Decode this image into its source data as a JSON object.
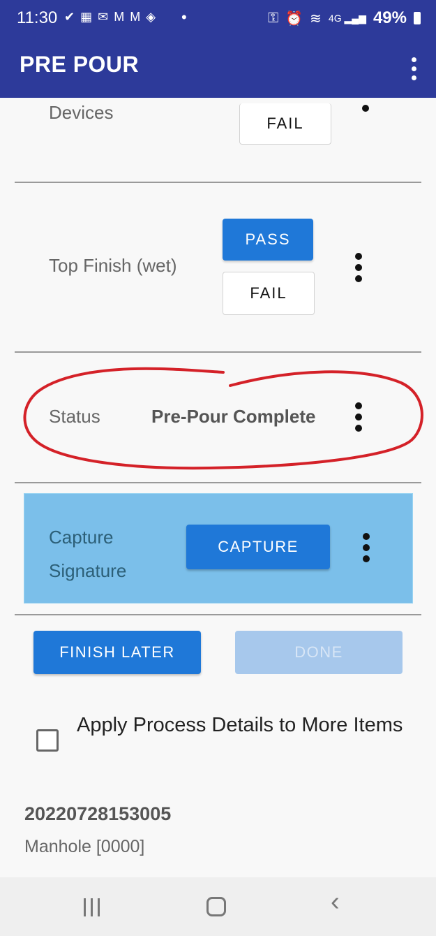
{
  "status_bar": {
    "time": "11:30",
    "battery": "49%",
    "left_icons": [
      "check-circle-icon",
      "calendar-icon",
      "outlook-icon",
      "gmail-icon",
      "gmail-icon",
      "shield-wifi-icon"
    ],
    "right_icons": [
      "key-icon",
      "alarm-icon",
      "wifi-icon",
      "4g-icon",
      "signal-icon",
      "battery-icon"
    ]
  },
  "app_bar": {
    "title": "PRE POUR",
    "menu_icon": "more-vert-icon"
  },
  "devices_row": {
    "label": "Devices",
    "fail_label": "FAIL"
  },
  "top_finish_row": {
    "label": "Top Finish (wet)",
    "pass_label": "PASS",
    "fail_label": "FAIL"
  },
  "status_row": {
    "label": "Status",
    "value": "Pre-Pour Complete"
  },
  "capture_row": {
    "label_line1": "Capture",
    "label_line2": "Signature",
    "button_label": "CAPTURE"
  },
  "actions": {
    "finish_later": "FINISH LATER",
    "done": "DONE"
  },
  "apply_details": {
    "label": "Apply Process Details to More Items",
    "checked": false
  },
  "item": {
    "id": "20220728153005",
    "subtitle": "Manhole [0000]"
  },
  "colors": {
    "app_bar": "#2d3a9a",
    "primary_button": "#1f78d8",
    "disabled_button": "#a7c8ec",
    "capture_panel": "#7bbfea",
    "annotation": "#d42128"
  }
}
